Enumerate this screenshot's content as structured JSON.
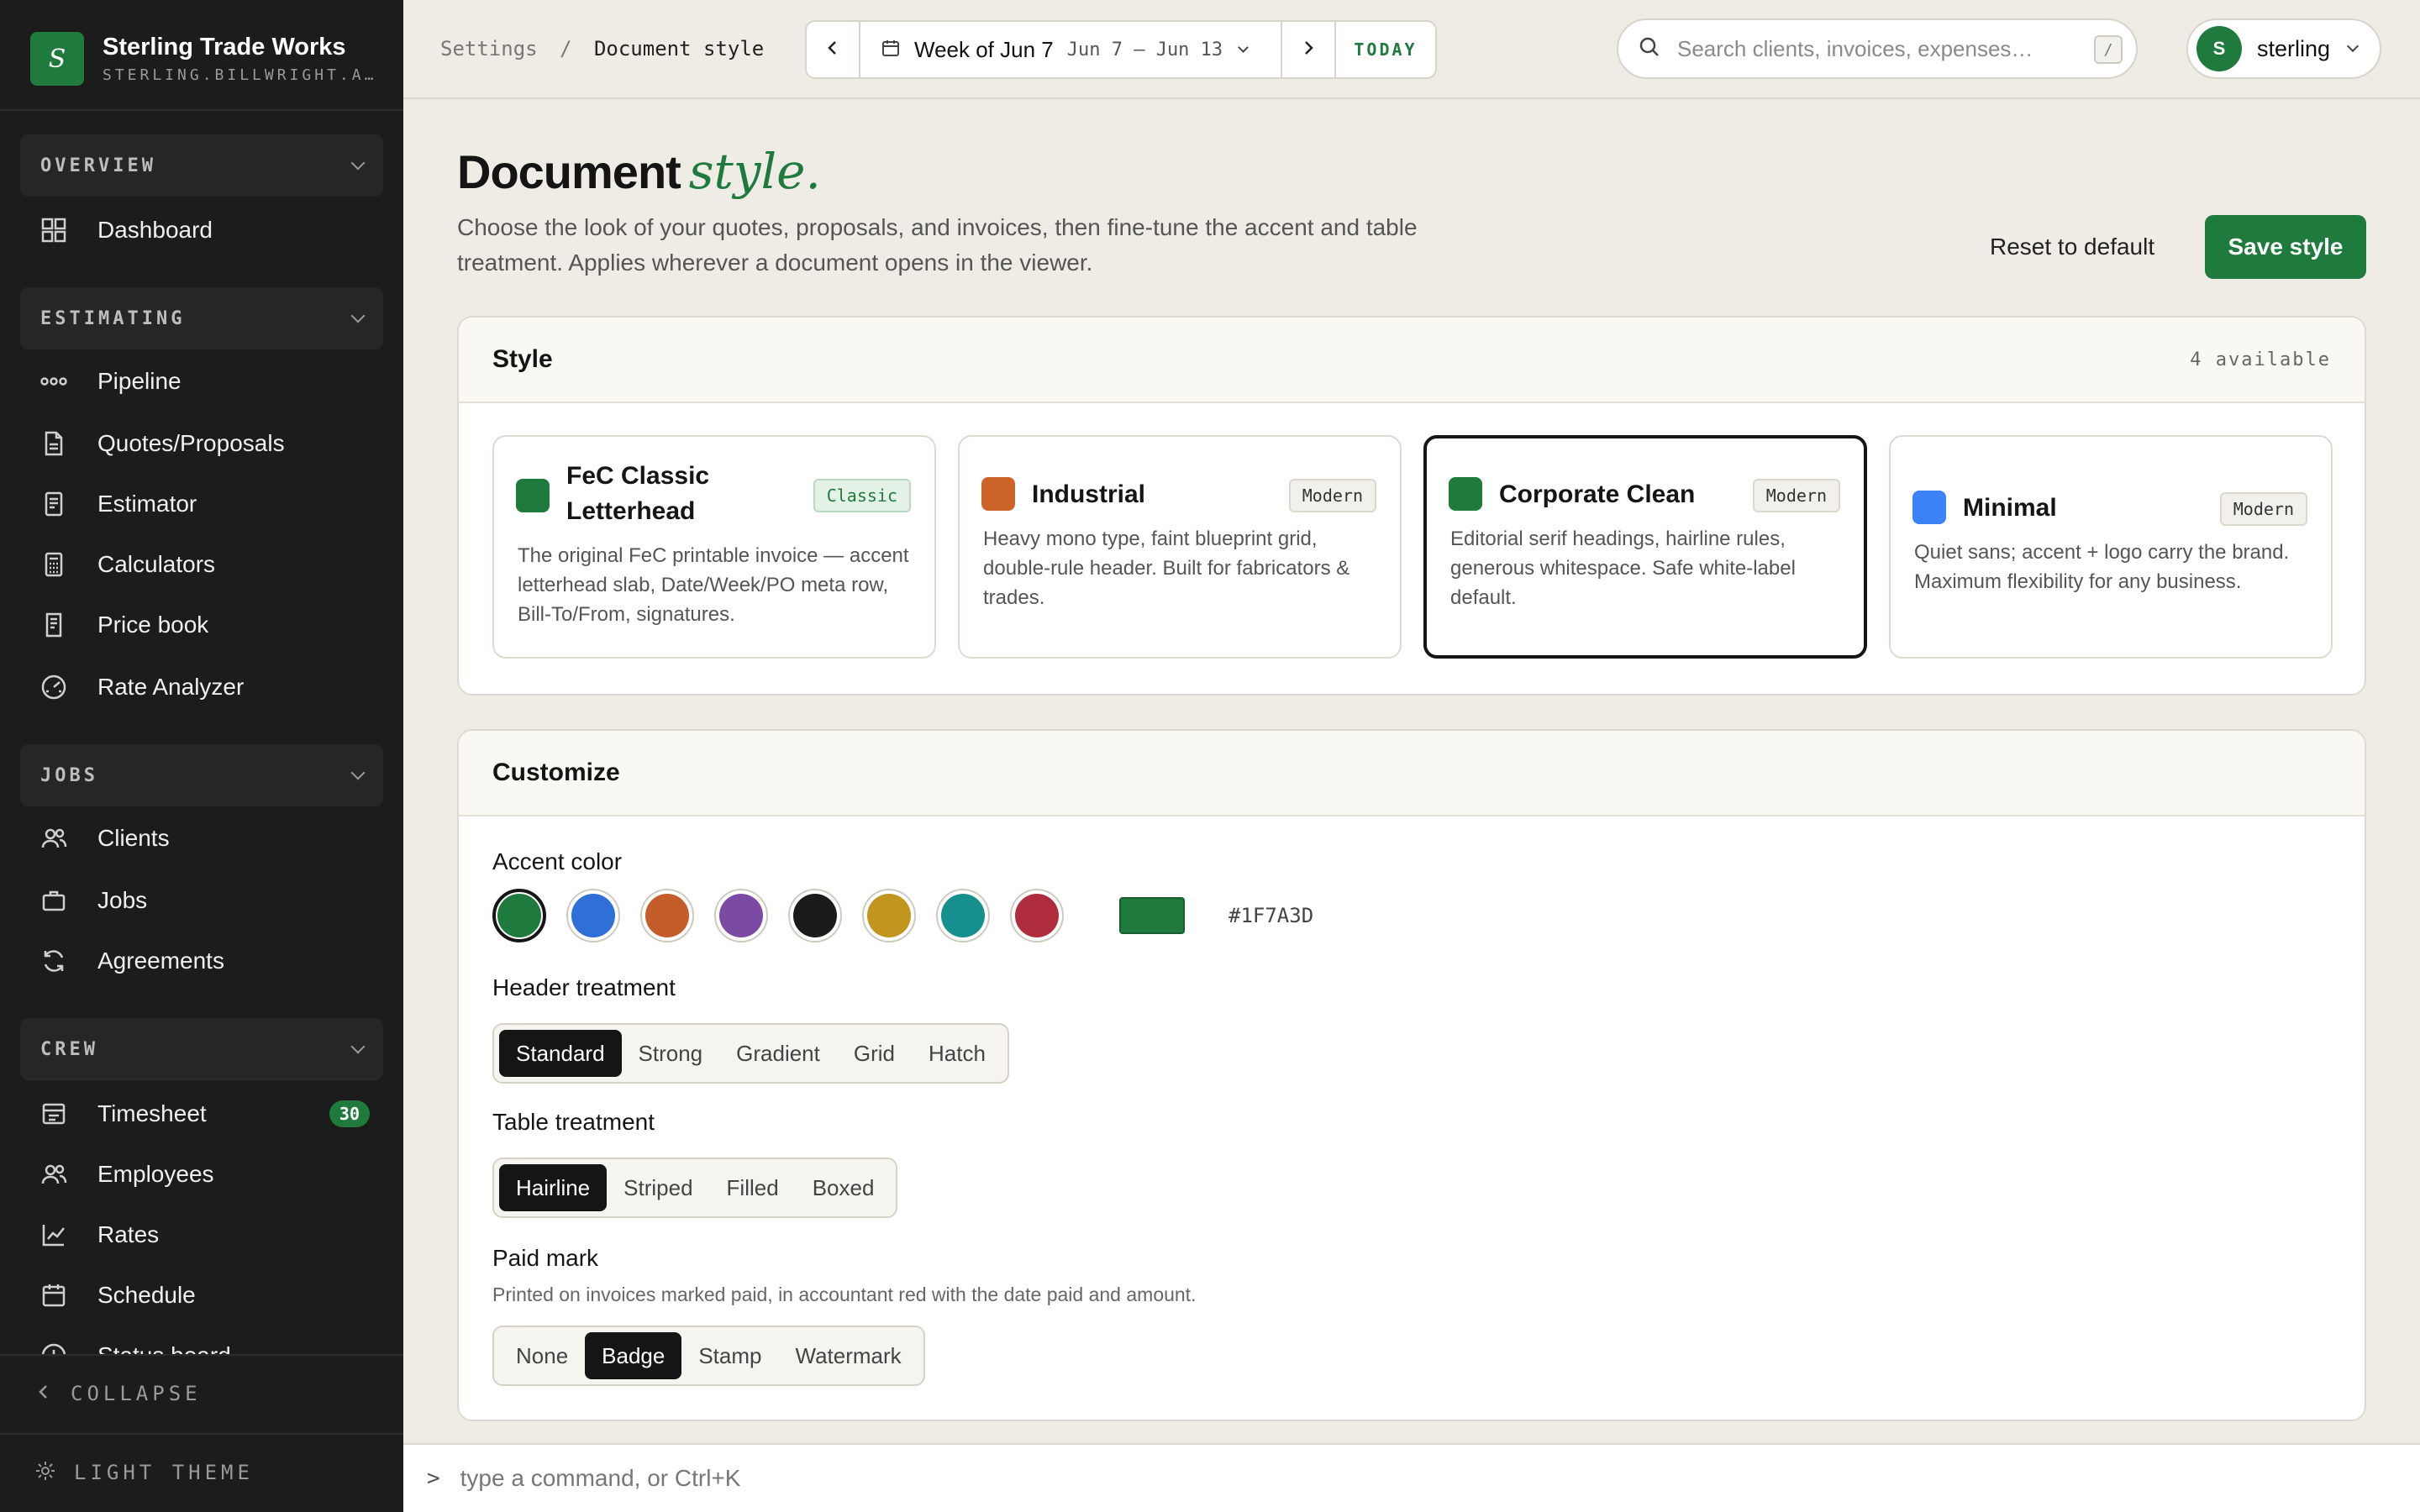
{
  "brand": {
    "name": "Sterling Trade Works",
    "sub": "STERLING.BILLWRIGHT.A…",
    "logo_letter": "S"
  },
  "sidebar": {
    "sections": [
      {
        "title": "OVERVIEW",
        "items": [
          {
            "label": "Dashboard",
            "icon": "grid-icon"
          }
        ]
      },
      {
        "title": "ESTIMATING",
        "items": [
          {
            "label": "Pipeline",
            "icon": "pipeline-icon"
          },
          {
            "label": "Quotes/Proposals",
            "icon": "document-icon"
          },
          {
            "label": "Estimator",
            "icon": "document-lines-icon"
          },
          {
            "label": "Calculators",
            "icon": "calculator-icon"
          },
          {
            "label": "Price book",
            "icon": "book-icon"
          },
          {
            "label": "Rate Analyzer",
            "icon": "gauge-icon"
          }
        ]
      },
      {
        "title": "JOBS",
        "items": [
          {
            "label": "Clients",
            "icon": "users-icon"
          },
          {
            "label": "Jobs",
            "icon": "briefcase-icon"
          },
          {
            "label": "Agreements",
            "icon": "refresh-icon"
          }
        ]
      },
      {
        "title": "CREW",
        "items": [
          {
            "label": "Timesheet",
            "icon": "timesheet-icon",
            "badge": "30"
          },
          {
            "label": "Employees",
            "icon": "users-icon"
          },
          {
            "label": "Rates",
            "icon": "chart-icon"
          },
          {
            "label": "Schedule",
            "icon": "calendar-icon"
          },
          {
            "label": "Status board",
            "icon": "clock-icon"
          }
        ]
      }
    ],
    "collapse_label": "COLLAPSE",
    "theme_label": "LIGHT THEME"
  },
  "topbar": {
    "breadcrumb_root": "Settings",
    "breadcrumb_sep": "/",
    "breadcrumb_current": "Document style",
    "week_label": "Week of Jun 7",
    "week_range": "Jun 7 – Jun 13",
    "today_label": "TODAY",
    "search_placeholder": "Search clients, invoices, expenses…",
    "search_kbd": "/",
    "user_initial": "S",
    "user_name": "sterling"
  },
  "page": {
    "title": "Document",
    "title_accent": "style.",
    "description": "Choose the look of your quotes, proposals, and invoices, then fine-tune the accent and table treatment. Applies wherever a document opens in the viewer.",
    "reset_label": "Reset to default",
    "save_label": "Save style"
  },
  "style_panel": {
    "title": "Style",
    "available": "4 available",
    "cards": [
      {
        "name": "FeC Classic Letterhead",
        "tag": "Classic",
        "color": "#1f7a3d",
        "desc": "The original FeC printable invoice — accent letterhead slab, Date/Week/PO meta row, Bill-To/From, signatures.",
        "selected": false
      },
      {
        "name": "Industrial",
        "tag": "Modern",
        "color": "#cc6429",
        "desc": "Heavy mono type, faint blueprint grid, double-rule header. Built for fabricators & trades.",
        "selected": false
      },
      {
        "name": "Corporate Clean",
        "tag": "Modern",
        "color": "#1f7a3d",
        "desc": "Editorial serif headings, hairline rules, generous whitespace. Safe white-label default.",
        "selected": true
      },
      {
        "name": "Minimal",
        "tag": "Modern",
        "color": "#3b82f6",
        "desc": "Quiet sans; accent + logo carry the brand. Maximum flexibility for any business.",
        "selected": false
      }
    ]
  },
  "customize": {
    "title": "Customize",
    "accent_label": "Accent color",
    "accent_colors": [
      "#1f7a3d",
      "#2f6fd8",
      "#c45d2a",
      "#7b4aa3",
      "#1b1b1b",
      "#c2951f",
      "#16908e",
      "#b02d3e"
    ],
    "accent_hex": "#1F7A3D",
    "header_label": "Header treatment",
    "header_options": [
      "Standard",
      "Strong",
      "Gradient",
      "Grid",
      "Hatch"
    ],
    "header_selected": "Standard",
    "table_label": "Table treatment",
    "table_options": [
      "Hairline",
      "Striped",
      "Filled",
      "Boxed"
    ],
    "table_selected": "Hairline",
    "paid_label": "Paid mark",
    "paid_sub": "Printed on invoices marked paid, in accountant red with the date paid and amount.",
    "paid_options": [
      "None",
      "Badge",
      "Stamp",
      "Watermark"
    ],
    "paid_selected": "Badge"
  },
  "command": {
    "prompt": ">",
    "placeholder": "type a command, or Ctrl+K"
  }
}
